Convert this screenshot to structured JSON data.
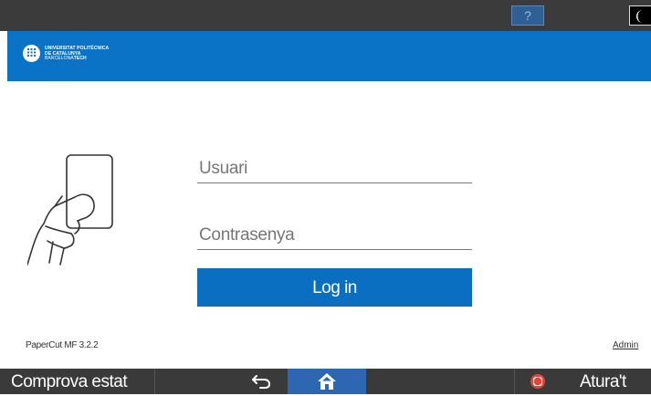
{
  "topbar": {
    "help_label": "?",
    "night_icon": "moon-icon"
  },
  "brand": {
    "line1": "UNIVERSITAT POLITÈCNICA",
    "line2": "DE CATALUNYA",
    "line3_a": "BARCELONA",
    "line3_b": "TECH",
    "logo_icon": "upc-logo-icon"
  },
  "login": {
    "username_placeholder": "Usuari",
    "password_placeholder": "Contrasenya",
    "button_label": "Log in",
    "illustration_icon": "card-hand-icon"
  },
  "footer": {
    "version": "PaperCut MF 3.2.2",
    "admin_label": "Admin"
  },
  "bottombar": {
    "status_label": "Comprova estat",
    "back_icon": "back-arrow-icon",
    "home_icon": "home-icon",
    "stop_icon": "stop-icon",
    "stop_label": "Atura't"
  },
  "colors": {
    "brand_blue": "#0b73c5",
    "button_blue": "#0b6fc1",
    "home_blue": "#2d67b2",
    "stop_red": "#e2453c",
    "bar_dark": "#3a3a3a"
  }
}
